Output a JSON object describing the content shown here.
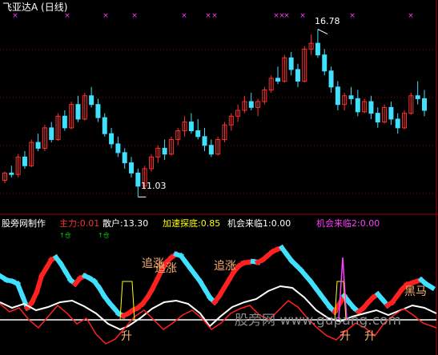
{
  "main_panel": {
    "title": "飞亚达A (日线)",
    "high_label": "16.78",
    "low_label": "11.03",
    "colors": {
      "up": "#ff3030",
      "down": "#40e0ff",
      "marker": "#ff40ff"
    }
  },
  "indicator_panel": {
    "source": "股旁网制作",
    "zhuli": "主力:0.01",
    "sanhu": "散户:13.30",
    "jiasu": "加速探底:0.85",
    "jihui1": "机会来临1:0.00",
    "jihui2": "机会来临2:0.00",
    "small_tags": [
      "↑仓",
      "↑仓"
    ],
    "tags": [
      "追涨",
      "追涨",
      "追涨",
      "升",
      "升",
      "升",
      "黑马"
    ],
    "colors": {
      "zhuli": "#ff3030",
      "sanhu": "#ffffff",
      "jiasu": "#ffff00",
      "jihui2": "#ff40ff"
    }
  },
  "watermark": "股旁网 www.gupang.com",
  "chart_data": [
    {
      "type": "candlestick",
      "title": "飞亚达A (日线)",
      "high": 16.78,
      "low": 11.03,
      "ylim": [
        10.6,
        17.4
      ],
      "candles": [
        [
          11.6,
          11.9,
          11.5,
          11.85
        ],
        [
          11.85,
          12.1,
          11.7,
          11.8
        ],
        [
          11.8,
          12.5,
          11.7,
          12.4
        ],
        [
          12.4,
          12.6,
          12.0,
          12.1
        ],
        [
          12.1,
          13.0,
          12.05,
          12.9
        ],
        [
          12.9,
          13.2,
          12.6,
          12.7
        ],
        [
          12.7,
          13.5,
          12.6,
          13.4
        ],
        [
          13.4,
          13.6,
          12.9,
          13.0
        ],
        [
          13.0,
          13.9,
          12.95,
          13.8
        ],
        [
          13.8,
          14.0,
          13.3,
          13.4
        ],
        [
          13.4,
          14.3,
          13.35,
          14.2
        ],
        [
          14.2,
          14.5,
          13.6,
          13.7
        ],
        [
          13.7,
          14.6,
          13.65,
          14.5
        ],
        [
          14.5,
          14.8,
          14.1,
          14.2
        ],
        [
          14.2,
          14.4,
          13.6,
          13.75
        ],
        [
          13.75,
          13.9,
          13.1,
          13.2
        ],
        [
          13.2,
          13.4,
          12.7,
          12.85
        ],
        [
          12.85,
          13.1,
          12.4,
          12.55
        ],
        [
          12.55,
          12.7,
          12.0,
          12.2
        ],
        [
          12.2,
          12.4,
          11.7,
          11.85
        ],
        [
          11.85,
          12.0,
          11.03,
          11.4
        ],
        [
          11.4,
          12.1,
          11.3,
          12.0
        ],
        [
          12.0,
          12.5,
          11.9,
          12.4
        ],
        [
          12.4,
          12.8,
          12.2,
          12.7
        ],
        [
          12.7,
          13.0,
          12.3,
          12.5
        ],
        [
          12.5,
          13.1,
          12.45,
          13.0
        ],
        [
          13.0,
          13.4,
          12.8,
          13.3
        ],
        [
          13.3,
          13.8,
          13.1,
          13.6
        ],
        [
          13.6,
          13.9,
          13.2,
          13.3
        ],
        [
          13.3,
          13.7,
          13.0,
          13.1
        ],
        [
          13.1,
          13.4,
          12.6,
          12.8
        ],
        [
          12.8,
          13.0,
          12.4,
          12.5
        ],
        [
          12.5,
          13.1,
          12.45,
          13.0
        ],
        [
          13.0,
          13.6,
          12.9,
          13.5
        ],
        [
          13.5,
          13.9,
          13.3,
          13.8
        ],
        [
          13.8,
          14.2,
          13.6,
          14.0
        ],
        [
          14.0,
          14.5,
          13.9,
          14.3
        ],
        [
          14.3,
          14.6,
          14.0,
          14.1
        ],
        [
          14.1,
          14.4,
          13.8,
          14.3
        ],
        [
          14.3,
          14.8,
          14.2,
          14.7
        ],
        [
          14.7,
          15.2,
          14.6,
          15.1
        ],
        [
          15.1,
          15.5,
          14.9,
          15.0
        ],
        [
          15.0,
          15.9,
          14.95,
          15.8
        ],
        [
          15.8,
          16.0,
          15.2,
          15.4
        ],
        [
          15.4,
          15.6,
          14.8,
          15.0
        ],
        [
          15.0,
          16.2,
          14.95,
          16.1
        ],
        [
          16.1,
          16.6,
          15.9,
          16.3
        ],
        [
          16.3,
          16.78,
          15.8,
          15.9
        ],
        [
          15.9,
          16.1,
          15.2,
          15.35
        ],
        [
          15.35,
          15.5,
          14.6,
          14.8
        ],
        [
          14.8,
          15.0,
          14.0,
          14.2
        ],
        [
          14.2,
          14.6,
          14.0,
          14.5
        ],
        [
          14.5,
          14.8,
          14.2,
          14.4
        ],
        [
          14.4,
          14.7,
          13.8,
          13.95
        ],
        [
          13.95,
          14.4,
          13.9,
          14.3
        ],
        [
          14.3,
          14.5,
          13.7,
          13.9
        ],
        [
          13.9,
          14.1,
          13.4,
          13.6
        ],
        [
          13.6,
          14.2,
          13.55,
          14.1
        ],
        [
          14.1,
          14.3,
          13.5,
          13.7
        ],
        [
          13.7,
          13.9,
          13.2,
          13.4
        ],
        [
          13.4,
          14.0,
          13.35,
          13.9
        ],
        [
          13.9,
          14.6,
          13.85,
          14.5
        ],
        [
          14.5,
          15.0,
          14.2,
          14.4
        ],
        [
          14.4,
          14.7,
          13.8,
          14.0
        ]
      ]
    }
  ]
}
